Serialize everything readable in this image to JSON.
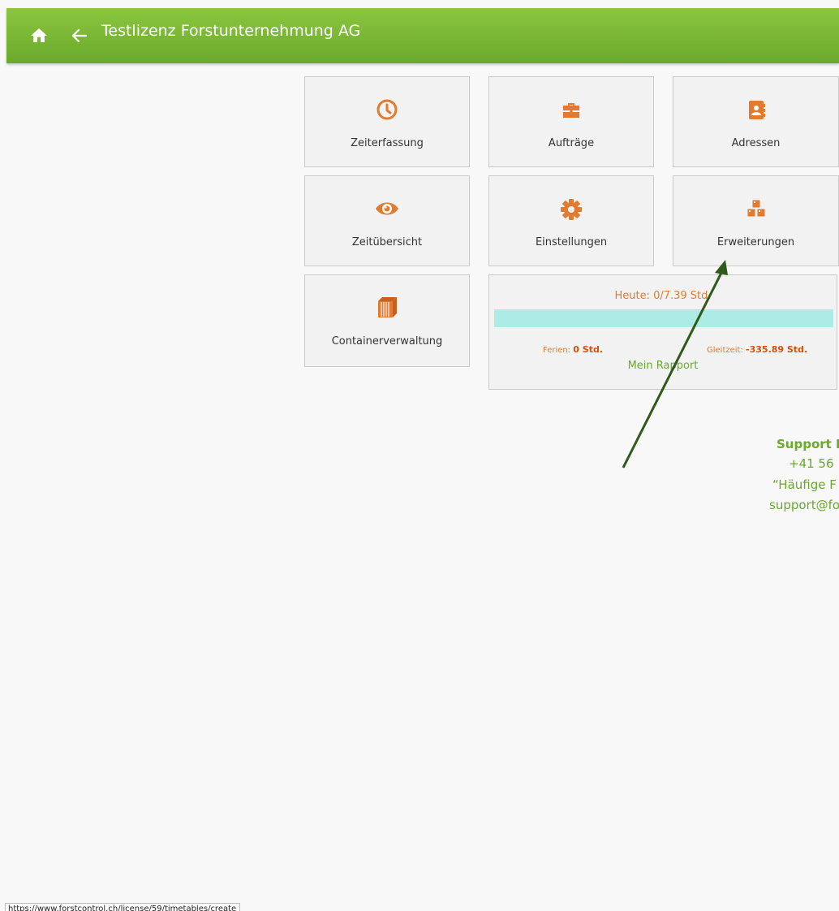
{
  "header": {
    "title": "Testlizenz Forstunternehmung AG",
    "home_icon": "home-icon",
    "back_icon": "arrow-left-icon",
    "background_color": "#7cb936"
  },
  "tiles": [
    {
      "label": "Zeiterfassung",
      "icon": "clock-icon"
    },
    {
      "label": "Aufträge",
      "icon": "briefcase-icon"
    },
    {
      "label": "Adressen",
      "icon": "address-book-icon"
    },
    {
      "label": "Zeitübersicht",
      "icon": "eye-icon"
    },
    {
      "label": "Einstellungen",
      "icon": "gear-icon"
    },
    {
      "label": "Erweiterungen",
      "icon": "cubes-icon"
    },
    {
      "label": "Containerverwaltung",
      "icon": "container-icon"
    }
  ],
  "hours_card": {
    "today": "Heute: 0/7.39 Std.",
    "ferien_label": "Ferien:",
    "ferien_value": "0 Std.",
    "gleitzeit_label": "Gleitzeit:",
    "gleitzeit_value": "-335.89 Std.",
    "link": "Mein Rapport"
  },
  "support": {
    "title": "Support F",
    "phone": "+41 56",
    "faq": "“Häufige F",
    "email": "support@fo"
  },
  "status_bar": {
    "url": "https://www.forstcontrol.ch/license/59/timetables/create"
  },
  "colors": {
    "accent_orange": "#e07b30",
    "accent_green": "#6aa92c",
    "progress_bar": "#adebe5",
    "annotation_arrow": "#2f5a1a"
  }
}
